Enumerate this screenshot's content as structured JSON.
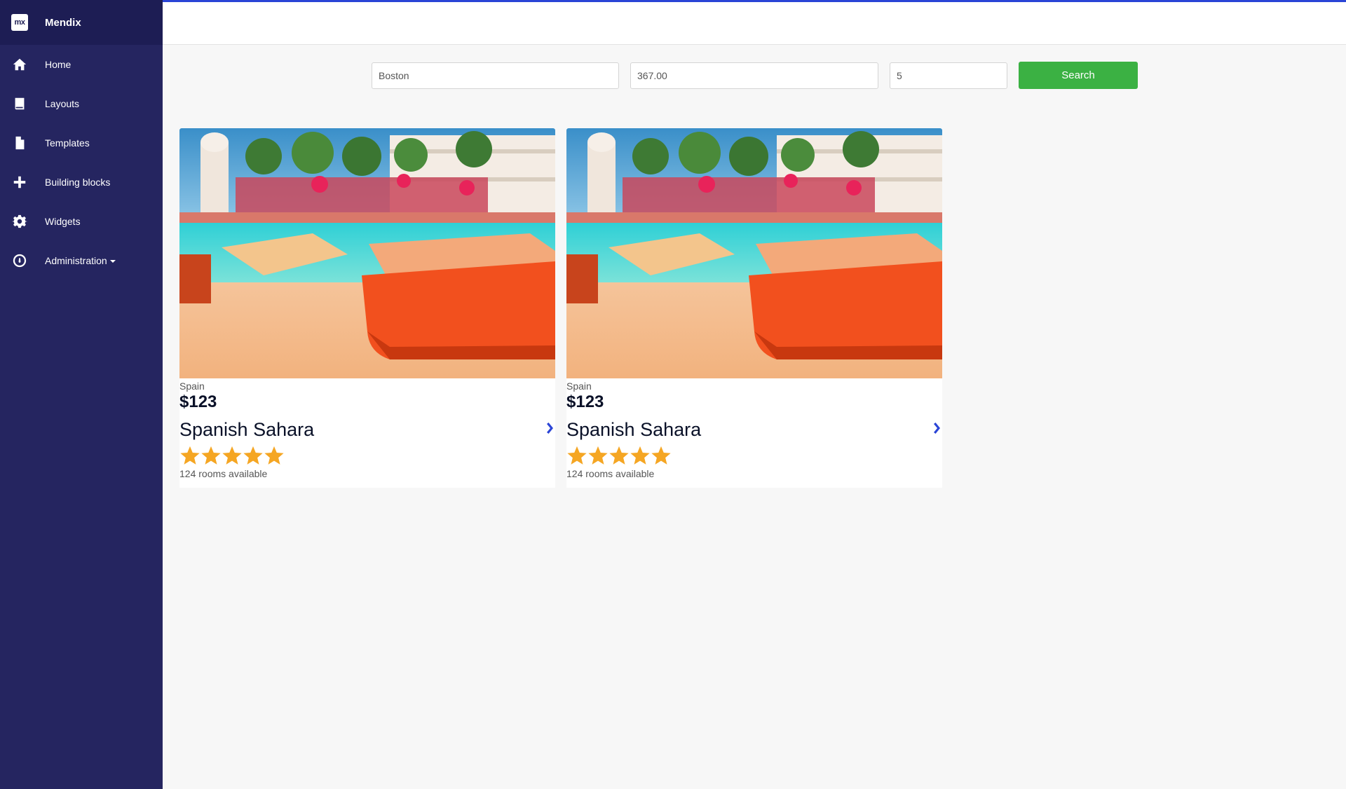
{
  "brand": {
    "logo_text": "mx",
    "name": "Mendix"
  },
  "sidebar": {
    "items": [
      {
        "label": "Home",
        "icon": "home-icon"
      },
      {
        "label": "Layouts",
        "icon": "book-icon"
      },
      {
        "label": "Templates",
        "icon": "file-icon"
      },
      {
        "label": "Building blocks",
        "icon": "plus-icon"
      },
      {
        "label": "Widgets",
        "icon": "gear-icon"
      },
      {
        "label": "Administration",
        "icon": "dashboard-icon"
      }
    ]
  },
  "search": {
    "city": "Boston",
    "price": "367.00",
    "count": "5",
    "button_label": "Search"
  },
  "cards": [
    {
      "country": "Spain",
      "price": "$123",
      "name": "Spanish Sahara",
      "rating": 5,
      "rooms": "124 rooms available"
    },
    {
      "country": "Spain",
      "price": "$123",
      "name": "Spanish Sahara",
      "rating": 5,
      "rooms": "124 rooms available"
    }
  ],
  "colors": {
    "sidebar": "#252560",
    "brand_bar": "#1d1d54",
    "accent": "#2a44d6",
    "search_button": "#3bb143",
    "star": "#f5a623"
  }
}
